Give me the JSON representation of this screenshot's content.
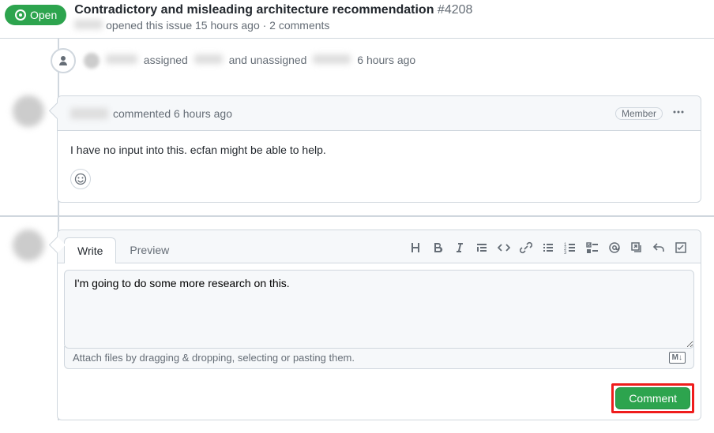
{
  "header": {
    "status": "Open",
    "title": "Contradictory and misleading architecture recommendation",
    "issue_number": "#4208",
    "subtitle_opened": "opened this issue 15 hours ago · 2 comments"
  },
  "event": {
    "assigned_word": "assigned",
    "unassigned_phrase": "and unassigned",
    "time": "6 hours ago"
  },
  "comment": {
    "action": "commented",
    "time": "6 hours ago",
    "role": "Member",
    "body": "I have no input into this. ecfan might be able to help."
  },
  "editor": {
    "tab_write": "Write",
    "tab_preview": "Preview",
    "value": "I'm going to do some more research on this.",
    "attach_hint": "Attach files by dragging & dropping, selecting or pasting them.",
    "md_label": "M↓",
    "submit": "Comment"
  },
  "toolbar_icons": [
    "heading",
    "bold",
    "italic",
    "quote",
    "code",
    "link",
    "ul",
    "ol",
    "tasklist",
    "mention",
    "crossref",
    "reply",
    "saved"
  ]
}
